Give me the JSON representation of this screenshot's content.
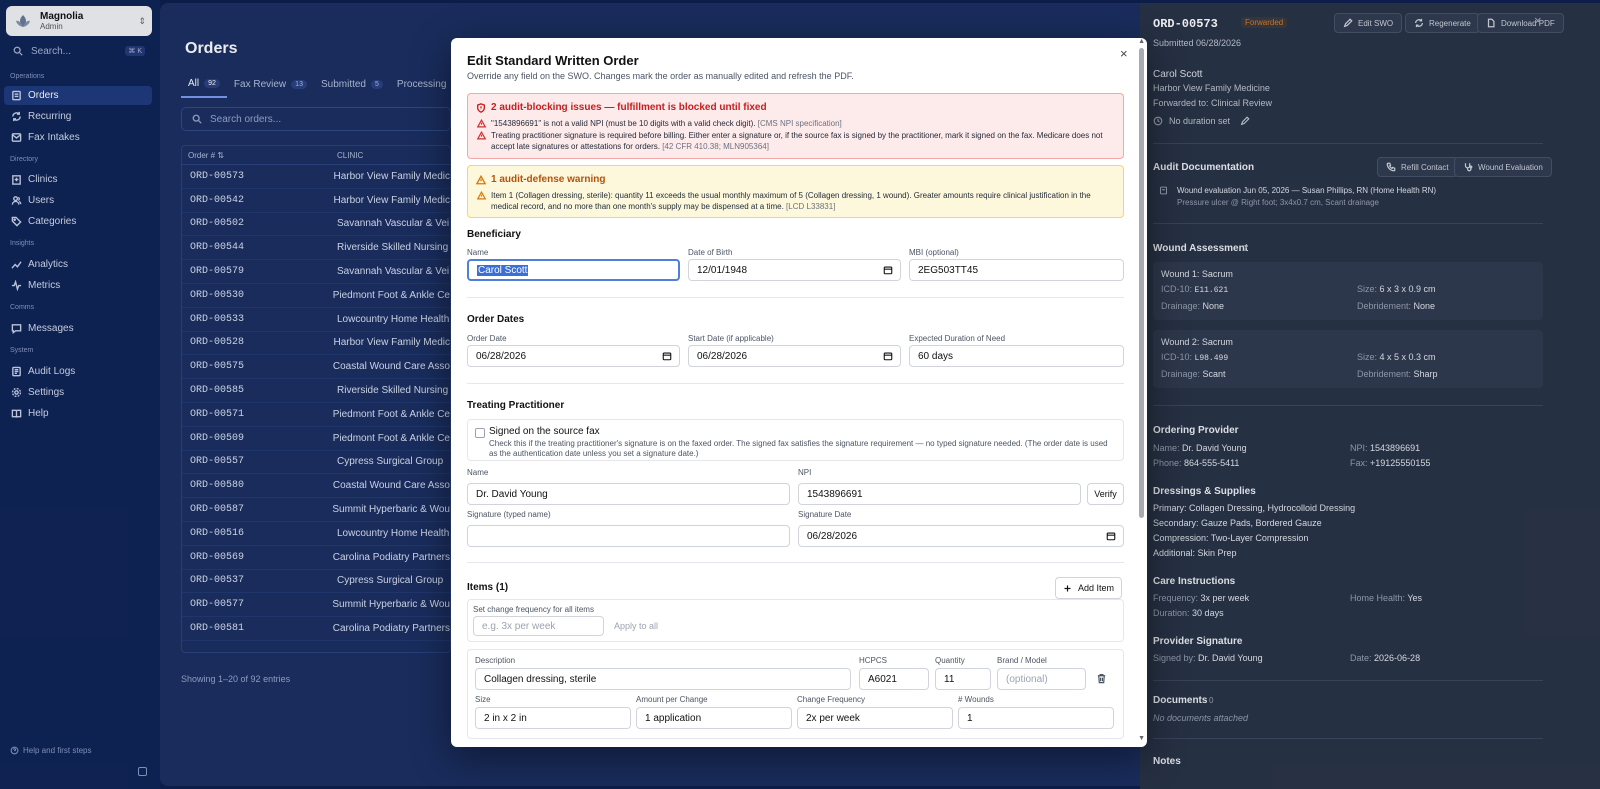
{
  "sidebar": {
    "workspace_name": "Magnolia",
    "workspace_role": "Admin",
    "search_placeholder": "Search...",
    "search_shortcut": "⌘ K",
    "sections": [
      "Operations",
      "Directory",
      "Insights",
      "Comms",
      "System"
    ],
    "items": [
      {
        "label": "Orders",
        "icon": "orders-icon"
      },
      {
        "label": "Recurring",
        "icon": "recurring-icon"
      },
      {
        "label": "Fax Intakes",
        "icon": "fax-icon"
      },
      {
        "label": "Clinics",
        "icon": "clinics-icon"
      },
      {
        "label": "Users",
        "icon": "users-icon"
      },
      {
        "label": "Categories",
        "icon": "categories-icon"
      },
      {
        "label": "Analytics",
        "icon": "analytics-icon"
      },
      {
        "label": "Metrics",
        "icon": "metrics-icon"
      },
      {
        "label": "Messages",
        "icon": "messages-icon"
      },
      {
        "label": "Audit Logs",
        "icon": "audit-icon"
      },
      {
        "label": "Settings",
        "icon": "settings-icon"
      },
      {
        "label": "Help",
        "icon": "help-icon"
      }
    ],
    "help_text": "Help and first steps"
  },
  "orders": {
    "title": "Orders",
    "tabs": [
      {
        "label": "All",
        "count": "92"
      },
      {
        "label": "Fax Review",
        "count": "13"
      },
      {
        "label": "Submitted",
        "count": "5"
      },
      {
        "label": "Processing",
        "count": ""
      }
    ],
    "search_placeholder": "Search orders...",
    "columns": [
      "Order # ⇅",
      "CLINIC"
    ],
    "rows": [
      {
        "id": "ORD-00573",
        "clinic": "Harbor View Family Medic"
      },
      {
        "id": "ORD-00542",
        "clinic": "Harbor View Family Medic"
      },
      {
        "id": "ORD-00502",
        "clinic": "Savannah Vascular & Vei"
      },
      {
        "id": "ORD-00544",
        "clinic": "Riverside Skilled Nursing"
      },
      {
        "id": "ORD-00579",
        "clinic": "Savannah Vascular & Vei"
      },
      {
        "id": "ORD-00530",
        "clinic": "Piedmont Foot & Ankle Ce"
      },
      {
        "id": "ORD-00533",
        "clinic": "Lowcountry Home Health"
      },
      {
        "id": "ORD-00528",
        "clinic": "Harbor View Family Medic"
      },
      {
        "id": "ORD-00575",
        "clinic": "Coastal Wound Care Asso"
      },
      {
        "id": "ORD-00585",
        "clinic": "Riverside Skilled Nursing"
      },
      {
        "id": "ORD-00571",
        "clinic": "Piedmont Foot & Ankle Ce"
      },
      {
        "id": "ORD-00509",
        "clinic": "Piedmont Foot & Ankle Ce"
      },
      {
        "id": "ORD-00557",
        "clinic": "Cypress Surgical Group"
      },
      {
        "id": "ORD-00580",
        "clinic": "Coastal Wound Care Asso"
      },
      {
        "id": "ORD-00587",
        "clinic": "Summit Hyperbaric & Wou"
      },
      {
        "id": "ORD-00516",
        "clinic": "Lowcountry Home Health"
      },
      {
        "id": "ORD-00569",
        "clinic": "Carolina Podiatry Partners"
      },
      {
        "id": "ORD-00537",
        "clinic": "Cypress Surgical Group"
      },
      {
        "id": "ORD-00577",
        "clinic": "Summit Hyperbaric & Wou"
      },
      {
        "id": "ORD-00581",
        "clinic": "Carolina Podiatry Partners"
      }
    ],
    "showing": "Showing 1–20 of 92 entries"
  },
  "panel": {
    "order_id": "ORD-00573",
    "status": "Forwarded",
    "edit_swo": "Edit SWO",
    "regenerate": "Regenerate",
    "download_pdf": "Download PDF",
    "submitted": "Submitted 06/28/2026",
    "patient": "Carol Scott",
    "clinic": "Harbor View Family Medicine",
    "forwarded_to": "Forwarded to: Clinical Review",
    "duration": "No duration set",
    "audit_heading": "Audit Documentation",
    "refill_contact": "Refill Contact",
    "wound_evaluation": "Wound Evaluation",
    "audit_entry_title": "Wound evaluation Jun 05, 2026 — Susan Phillips, RN (Home Health RN)",
    "audit_entry_detail": "Pressure ulcer @ Right foot; 3x4x0.7 cm, Scant drainage",
    "wound_heading": "Wound Assessment",
    "wound_count": "2",
    "wounds": [
      {
        "title": "Wound 1: Sacrum",
        "icd": "E11.621",
        "size": "6 x 3 x 0.9 cm",
        "drainage": "None",
        "debridement": "None"
      },
      {
        "title": "Wound 2: Sacrum",
        "icd": "L98.499",
        "size": "4 x 5 x 0.3 cm",
        "drainage": "Scant",
        "debridement": "Sharp"
      }
    ],
    "labels": {
      "icd": "ICD-10:",
      "size": "Size:",
      "drainage": "Drainage:",
      "debridement": "Debridement:",
      "name": "Name:",
      "npi": "NPI:",
      "phone": "Phone:",
      "fax": "Fax:",
      "frequency": "Frequency:",
      "home_health": "Home Health:",
      "duration": "Duration:",
      "signed_by": "Signed by:",
      "date": "Date:"
    },
    "provider_heading": "Ordering Provider",
    "provider_name": "Dr. David Young",
    "provider_npi": "1543896691",
    "provider_phone": "864-555-5411",
    "provider_fax": "+19125550155",
    "dressings_heading": "Dressings & Supplies",
    "dressings": [
      "Primary: Collagen Dressing, Hydrocolloid Dressing",
      "Secondary: Gauze Pads, Bordered Gauze",
      "Compression: Two-Layer Compression",
      "Additional: Skin Prep"
    ],
    "care_heading": "Care Instructions",
    "care_frequency": "3x per week",
    "care_home_health": "Yes",
    "care_duration": "30 days",
    "sig_heading": "Provider Signature",
    "sig_by": "Dr. David Young",
    "sig_date": "2026-06-28",
    "docs_heading": "Documents",
    "docs_count": "0",
    "docs_empty": "No documents attached",
    "notes_heading": "Notes"
  },
  "modal": {
    "title": "Edit Standard Written Order",
    "subtitle": "Override any field on the SWO. Changes mark the order as manually edited and refresh the PDF.",
    "error_title": "2 audit-blocking issues — fulfillment is blocked until fixed",
    "error_1": "\"1543896691\" is not a valid NPI (must be 10 digits with a valid check digit).",
    "error_1_cite": "[CMS NPI specification]",
    "error_2": "Treating practitioner signature is required before billing. Either enter a signature or, if the source fax is signed by the practitioner, mark it signed on the fax. Medicare does not accept late signatures or attestations for orders.",
    "error_2_cite": "[42 CFR 410.38; MLN905364]",
    "warn_title": "1 audit-defense warning",
    "warn_1": "Item 1 (Collagen dressing, sterile): quantity 11 exceeds the usual monthly maximum of 5 (Collagen dressing, 1 wound). Greater amounts require clinical justification in the medical record, and no more than one month's supply may be dispensed at a time.",
    "warn_1_cite": "[LCD L33831]",
    "beneficiary": {
      "heading": "Beneficiary",
      "name_label": "Name",
      "name": "Carol Scott",
      "dob_label": "Date of Birth",
      "dob": "12/01/1948",
      "mbi_label": "MBI (optional)",
      "mbi": "2EG503TT45"
    },
    "dates": {
      "heading": "Order Dates",
      "order_label": "Order Date",
      "order": "06/28/2026",
      "start_label": "Start Date (if applicable)",
      "start": "06/28/2026",
      "duration_label": "Expected Duration of Need",
      "duration": "60 days"
    },
    "practitioner": {
      "heading": "Treating Practitioner",
      "signed_label": "Signed on the source fax",
      "signed_help": "Check this if the treating practitioner's signature is on the faxed order. The signed fax satisfies the signature requirement — no typed signature needed. (The order date is used as the authentication date unless you set a signature date.)",
      "name_label": "Name",
      "name": "Dr. David Young",
      "npi_label": "NPI",
      "npi": "1543896691",
      "verify": "Verify",
      "sig_label": "Signature (typed name)",
      "sig": "",
      "sig_date_label": "Signature Date",
      "sig_date": "06/28/2026"
    },
    "items": {
      "heading": "Items (1)",
      "add": "Add Item",
      "freq_label": "Set change frequency for all items",
      "freq_placeholder": "e.g. 3x per week",
      "apply": "Apply to all",
      "desc_label": "Description",
      "desc": "Collagen dressing, sterile",
      "hcpcs_label": "HCPCS",
      "hcpcs": "A6021",
      "qty_label": "Quantity",
      "qty": "11",
      "brand_label": "Brand / Model",
      "brand_placeholder": "(optional)",
      "size_label": "Size",
      "size": "2 in x 2 in",
      "amount_label": "Amount per Change",
      "amount": "1 application",
      "change_label": "Change Frequency",
      "change": "2x per week",
      "wounds_label": "# Wounds",
      "wounds": "1"
    }
  }
}
